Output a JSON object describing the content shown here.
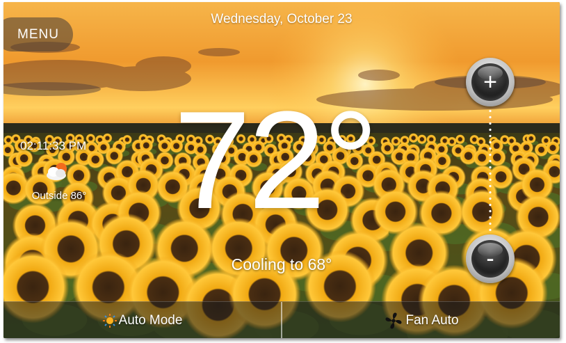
{
  "header": {
    "date": "Wednesday, October 23"
  },
  "menu": {
    "label": "MENU"
  },
  "thermostat": {
    "current_temp": "72°",
    "status": "Cooling to 68°",
    "increase_label": "+",
    "decrease_label": "-"
  },
  "side_info": {
    "time": "02:11:33 PM",
    "weather_icon": "partly-cloudy-icon",
    "outside": "Outside 86°"
  },
  "bottom_bar": {
    "mode_icon": "auto-mode-icon",
    "mode_label": "Auto Mode",
    "fan_icon": "fan-icon",
    "fan_label": "Fan Auto"
  },
  "colors": {
    "sky_top": "#f3a43a",
    "sky_glow": "#ffd66a",
    "petal": "#f5b318",
    "sunflower_center": "#3a2410",
    "foliage": "#4f6a24"
  }
}
